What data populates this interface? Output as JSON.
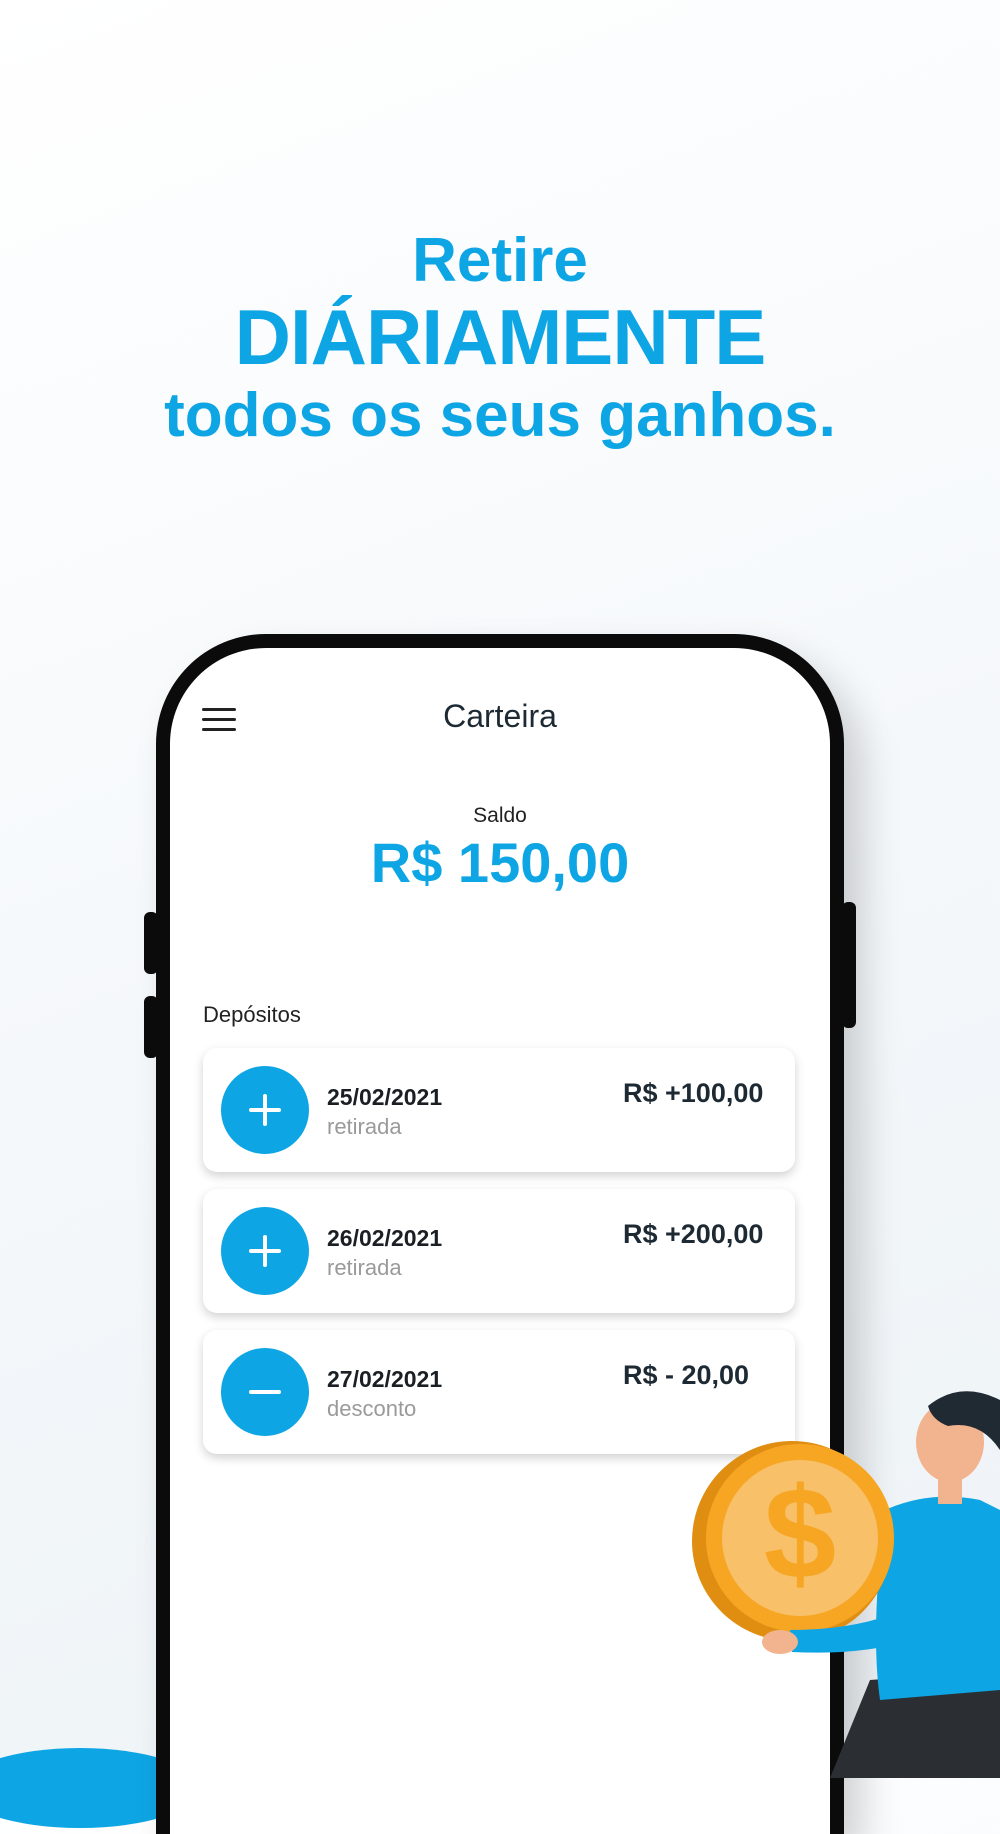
{
  "headline": {
    "line1": "Retire",
    "line2": "DIÁRIAMENTE",
    "line3": "todos os seus ganhos."
  },
  "app": {
    "title": "Carteira",
    "menu_icon": "hamburger-menu-icon"
  },
  "balance": {
    "label": "Saldo",
    "value": "R$ 150,00"
  },
  "deposits": {
    "label": "Depósitos",
    "items": [
      {
        "date": "25/02/2021",
        "type": "retirada",
        "amount": "R$ +100,00",
        "icon": "plus-icon"
      },
      {
        "date": "26/02/2021",
        "type": "retirada",
        "amount": "R$ +200,00",
        "icon": "plus-icon"
      },
      {
        "date": "27/02/2021",
        "type": "desconto",
        "amount": "R$ - 20,00",
        "icon": "minus-icon"
      }
    ]
  },
  "colors": {
    "accent": "#0ea5e4",
    "coin": "#f6a623",
    "text_dark": "#1e2a33"
  }
}
